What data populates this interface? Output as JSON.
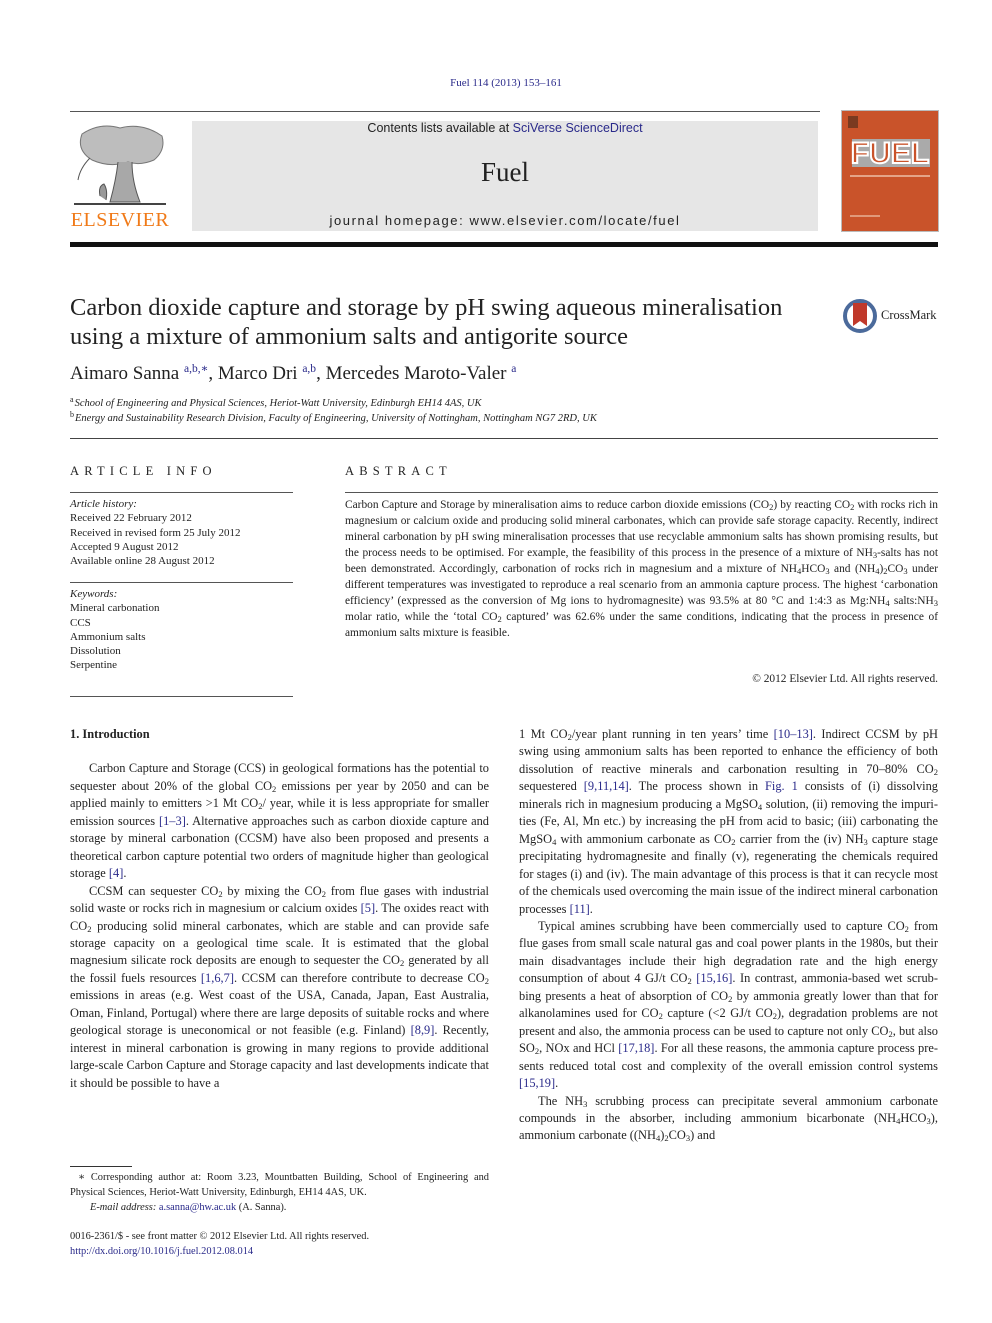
{
  "header": {
    "journal_ref": "Fuel 114 (2013) 153–161",
    "contents_prefix": "Contents lists available at ",
    "contents_link": "SciVerse ScienceDirect",
    "journal_name": "Fuel",
    "homepage": "journal homepage: www.elsevier.com/locate/fuel",
    "publisher_logo_text": "ELSEVIER",
    "cover_title": "FUEL"
  },
  "colors": {
    "link": "#2a2a8a",
    "elsevier_orange": "#f07a18",
    "cover_orange": "#c9532a",
    "banner_gray": "#e6e6e6"
  },
  "article": {
    "title": "Carbon dioxide capture and storage by pH swing aqueous mineralisation using a mixture of ammonium salts and antigorite source",
    "crossmark_label": "CrossMark",
    "authors": [
      {
        "name": "Aimaro Sanna",
        "sup": "a,b,∗"
      },
      {
        "name": "Marco Dri",
        "sup": "a,b"
      },
      {
        "name": "Mercedes Maroto-Valer",
        "sup": "a"
      }
    ],
    "affiliations": [
      {
        "mark": "a",
        "text": "School of Engineering and Physical Sciences, Heriot-Watt University, Edinburgh EH14 4AS, UK"
      },
      {
        "mark": "b",
        "text": "Energy and Sustainability Research Division, Faculty of Engineering, University of Nottingham, Nottingham NG7 2RD, UK"
      }
    ]
  },
  "article_info": {
    "heading": "ARTICLE INFO",
    "history_label": "Article history:",
    "history": [
      "Received 22 February 2012",
      "Received in revised form 25 July 2012",
      "Accepted 9 August 2012",
      "Available online 28 August 2012"
    ],
    "keywords_label": "Keywords:",
    "keywords": [
      "Mineral carbonation",
      "CCS",
      "Ammonium salts",
      "Dissolution",
      "Serpentine"
    ]
  },
  "abstract": {
    "heading": "ABSTRACT",
    "copyright": "© 2012 Elsevier Ltd. All rights reserved."
  },
  "body": {
    "section_heading": "1. Introduction"
  },
  "footnote": {
    "corresponding": "∗ Corresponding author at: Room 3.23, Mountbatten Building, School of Engineering and Physical Sciences, Heriot-Watt University, Edinburgh, EH14 4AS, UK.",
    "email_label": "E-mail address:",
    "email": "a.sanna@hw.ac.uk",
    "email_suffix": " (A. Sanna).",
    "issn": "0016-2361/$ - see front matter © 2012 Elsevier Ltd. All rights reserved.",
    "doi": "http://dx.doi.org/10.1016/j.fuel.2012.08.014"
  }
}
